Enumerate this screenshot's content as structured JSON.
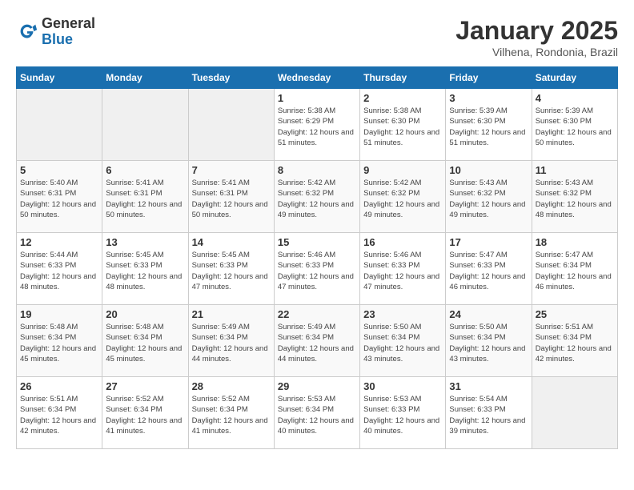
{
  "header": {
    "logo_general": "General",
    "logo_blue": "Blue",
    "title": "January 2025",
    "subtitle": "Vilhena, Rondonia, Brazil"
  },
  "days_of_week": [
    "Sunday",
    "Monday",
    "Tuesday",
    "Wednesday",
    "Thursday",
    "Friday",
    "Saturday"
  ],
  "weeks": [
    [
      {
        "day": "",
        "sunrise": "",
        "sunset": "",
        "daylight": "",
        "empty": true
      },
      {
        "day": "",
        "sunrise": "",
        "sunset": "",
        "daylight": "",
        "empty": true
      },
      {
        "day": "",
        "sunrise": "",
        "sunset": "",
        "daylight": "",
        "empty": true
      },
      {
        "day": "1",
        "sunrise": "Sunrise: 5:38 AM",
        "sunset": "Sunset: 6:29 PM",
        "daylight": "Daylight: 12 hours and 51 minutes."
      },
      {
        "day": "2",
        "sunrise": "Sunrise: 5:38 AM",
        "sunset": "Sunset: 6:30 PM",
        "daylight": "Daylight: 12 hours and 51 minutes."
      },
      {
        "day": "3",
        "sunrise": "Sunrise: 5:39 AM",
        "sunset": "Sunset: 6:30 PM",
        "daylight": "Daylight: 12 hours and 51 minutes."
      },
      {
        "day": "4",
        "sunrise": "Sunrise: 5:39 AM",
        "sunset": "Sunset: 6:30 PM",
        "daylight": "Daylight: 12 hours and 50 minutes."
      }
    ],
    [
      {
        "day": "5",
        "sunrise": "Sunrise: 5:40 AM",
        "sunset": "Sunset: 6:31 PM",
        "daylight": "Daylight: 12 hours and 50 minutes."
      },
      {
        "day": "6",
        "sunrise": "Sunrise: 5:41 AM",
        "sunset": "Sunset: 6:31 PM",
        "daylight": "Daylight: 12 hours and 50 minutes."
      },
      {
        "day": "7",
        "sunrise": "Sunrise: 5:41 AM",
        "sunset": "Sunset: 6:31 PM",
        "daylight": "Daylight: 12 hours and 50 minutes."
      },
      {
        "day": "8",
        "sunrise": "Sunrise: 5:42 AM",
        "sunset": "Sunset: 6:32 PM",
        "daylight": "Daylight: 12 hours and 49 minutes."
      },
      {
        "day": "9",
        "sunrise": "Sunrise: 5:42 AM",
        "sunset": "Sunset: 6:32 PM",
        "daylight": "Daylight: 12 hours and 49 minutes."
      },
      {
        "day": "10",
        "sunrise": "Sunrise: 5:43 AM",
        "sunset": "Sunset: 6:32 PM",
        "daylight": "Daylight: 12 hours and 49 minutes."
      },
      {
        "day": "11",
        "sunrise": "Sunrise: 5:43 AM",
        "sunset": "Sunset: 6:32 PM",
        "daylight": "Daylight: 12 hours and 48 minutes."
      }
    ],
    [
      {
        "day": "12",
        "sunrise": "Sunrise: 5:44 AM",
        "sunset": "Sunset: 6:33 PM",
        "daylight": "Daylight: 12 hours and 48 minutes."
      },
      {
        "day": "13",
        "sunrise": "Sunrise: 5:45 AM",
        "sunset": "Sunset: 6:33 PM",
        "daylight": "Daylight: 12 hours and 48 minutes."
      },
      {
        "day": "14",
        "sunrise": "Sunrise: 5:45 AM",
        "sunset": "Sunset: 6:33 PM",
        "daylight": "Daylight: 12 hours and 47 minutes."
      },
      {
        "day": "15",
        "sunrise": "Sunrise: 5:46 AM",
        "sunset": "Sunset: 6:33 PM",
        "daylight": "Daylight: 12 hours and 47 minutes."
      },
      {
        "day": "16",
        "sunrise": "Sunrise: 5:46 AM",
        "sunset": "Sunset: 6:33 PM",
        "daylight": "Daylight: 12 hours and 47 minutes."
      },
      {
        "day": "17",
        "sunrise": "Sunrise: 5:47 AM",
        "sunset": "Sunset: 6:33 PM",
        "daylight": "Daylight: 12 hours and 46 minutes."
      },
      {
        "day": "18",
        "sunrise": "Sunrise: 5:47 AM",
        "sunset": "Sunset: 6:34 PM",
        "daylight": "Daylight: 12 hours and 46 minutes."
      }
    ],
    [
      {
        "day": "19",
        "sunrise": "Sunrise: 5:48 AM",
        "sunset": "Sunset: 6:34 PM",
        "daylight": "Daylight: 12 hours and 45 minutes."
      },
      {
        "day": "20",
        "sunrise": "Sunrise: 5:48 AM",
        "sunset": "Sunset: 6:34 PM",
        "daylight": "Daylight: 12 hours and 45 minutes."
      },
      {
        "day": "21",
        "sunrise": "Sunrise: 5:49 AM",
        "sunset": "Sunset: 6:34 PM",
        "daylight": "Daylight: 12 hours and 44 minutes."
      },
      {
        "day": "22",
        "sunrise": "Sunrise: 5:49 AM",
        "sunset": "Sunset: 6:34 PM",
        "daylight": "Daylight: 12 hours and 44 minutes."
      },
      {
        "day": "23",
        "sunrise": "Sunrise: 5:50 AM",
        "sunset": "Sunset: 6:34 PM",
        "daylight": "Daylight: 12 hours and 43 minutes."
      },
      {
        "day": "24",
        "sunrise": "Sunrise: 5:50 AM",
        "sunset": "Sunset: 6:34 PM",
        "daylight": "Daylight: 12 hours and 43 minutes."
      },
      {
        "day": "25",
        "sunrise": "Sunrise: 5:51 AM",
        "sunset": "Sunset: 6:34 PM",
        "daylight": "Daylight: 12 hours and 42 minutes."
      }
    ],
    [
      {
        "day": "26",
        "sunrise": "Sunrise: 5:51 AM",
        "sunset": "Sunset: 6:34 PM",
        "daylight": "Daylight: 12 hours and 42 minutes."
      },
      {
        "day": "27",
        "sunrise": "Sunrise: 5:52 AM",
        "sunset": "Sunset: 6:34 PM",
        "daylight": "Daylight: 12 hours and 41 minutes."
      },
      {
        "day": "28",
        "sunrise": "Sunrise: 5:52 AM",
        "sunset": "Sunset: 6:34 PM",
        "daylight": "Daylight: 12 hours and 41 minutes."
      },
      {
        "day": "29",
        "sunrise": "Sunrise: 5:53 AM",
        "sunset": "Sunset: 6:34 PM",
        "daylight": "Daylight: 12 hours and 40 minutes."
      },
      {
        "day": "30",
        "sunrise": "Sunrise: 5:53 AM",
        "sunset": "Sunset: 6:33 PM",
        "daylight": "Daylight: 12 hours and 40 minutes."
      },
      {
        "day": "31",
        "sunrise": "Sunrise: 5:54 AM",
        "sunset": "Sunset: 6:33 PM",
        "daylight": "Daylight: 12 hours and 39 minutes."
      },
      {
        "day": "",
        "sunrise": "",
        "sunset": "",
        "daylight": "",
        "empty": true
      }
    ]
  ]
}
